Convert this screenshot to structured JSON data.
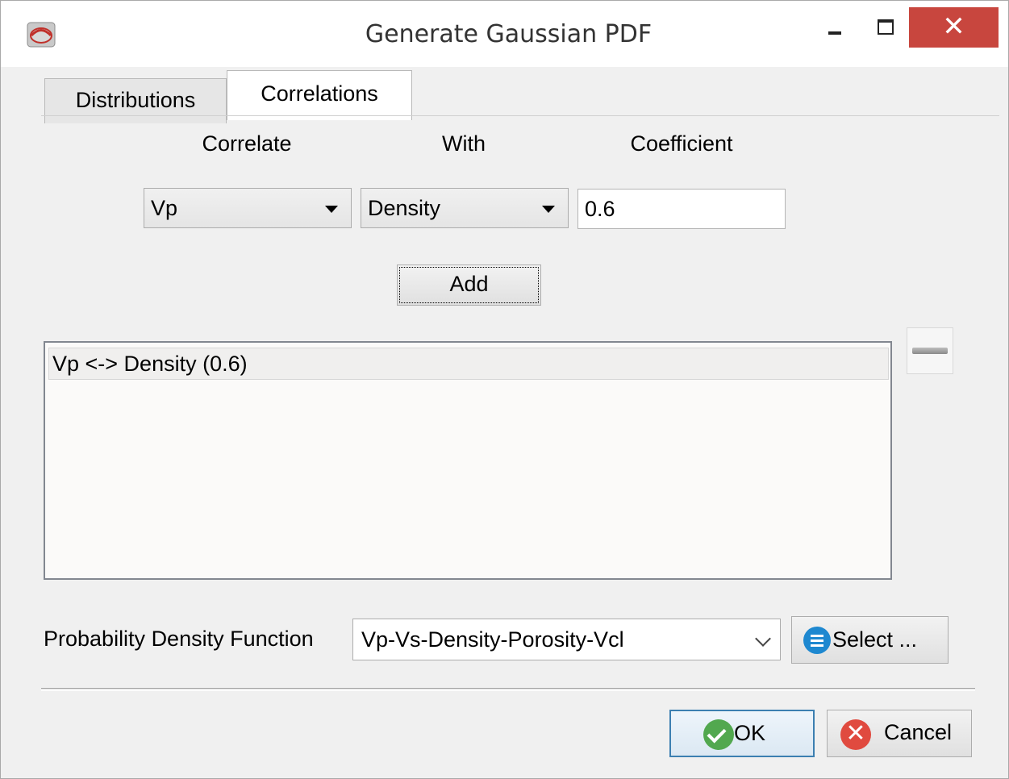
{
  "window": {
    "title": "Generate Gaussian PDF",
    "close_glyph": "✕"
  },
  "tabs": [
    {
      "label": "Distributions",
      "active": false
    },
    {
      "label": "Correlations",
      "active": true
    }
  ],
  "correlation_form": {
    "correlate_header": "Correlate",
    "with_header": "With",
    "coefficient_header": "Coefficient",
    "correlate_value": "Vp",
    "with_value": "Density",
    "coefficient_value": "0.6",
    "add_label": "Add"
  },
  "correlation_list": {
    "items": [
      "Vp <-> Density (0.6)"
    ]
  },
  "pdf": {
    "label": "Probability Density Function",
    "selected": "Vp-Vs-Density-Porosity-Vcl",
    "select_button_label": "Select ..."
  },
  "dialog_buttons": {
    "ok_label": "OK",
    "cancel_label": "Cancel",
    "cancel_glyph": "✕"
  },
  "colors": {
    "close_button": "#c8463e",
    "ok_icon": "#52a84f",
    "cancel_icon": "#e04a3f",
    "select_icon": "#1e88d0"
  }
}
